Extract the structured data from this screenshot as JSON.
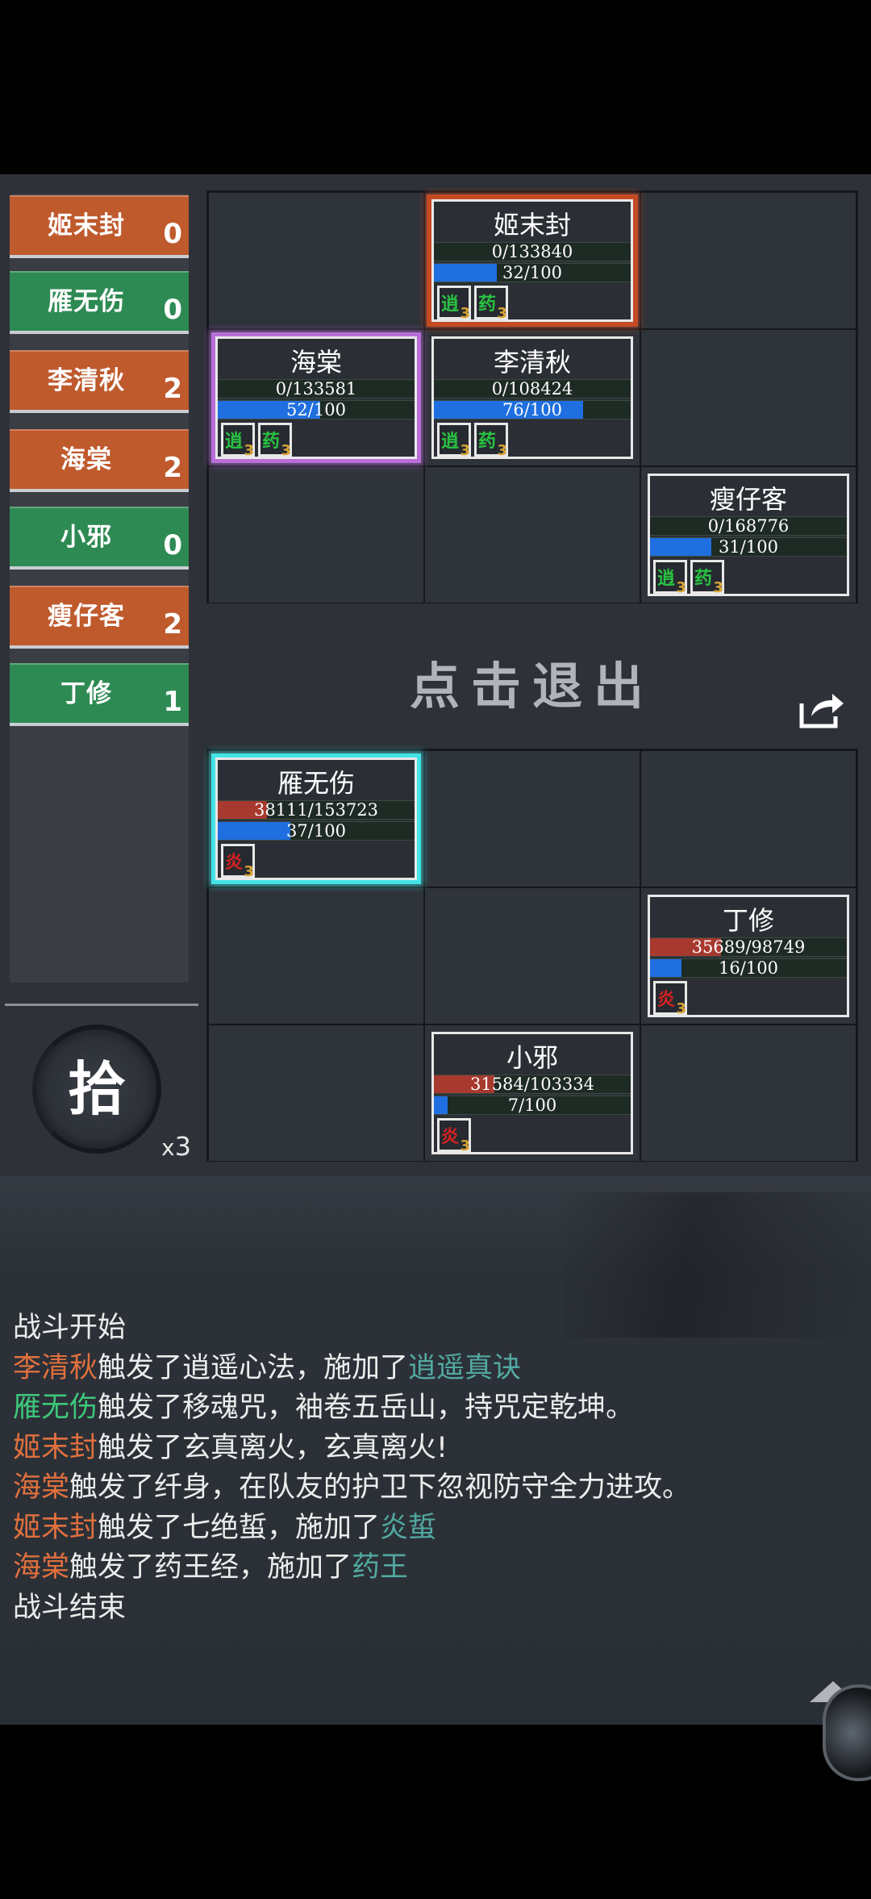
{
  "sidebar": {
    "items": [
      {
        "name": "姬末封",
        "count": "0",
        "color": "orange"
      },
      {
        "name": "雁无伤",
        "count": "0",
        "color": "green"
      },
      {
        "name": "李清秋",
        "count": "2",
        "color": "orange"
      },
      {
        "name": "海棠",
        "count": "2",
        "color": "orange"
      },
      {
        "name": "小邪",
        "count": "0",
        "color": "green"
      },
      {
        "name": "瘦仔客",
        "count": "2",
        "color": "orange"
      },
      {
        "name": "丁修",
        "count": "1",
        "color": "green"
      }
    ],
    "pick_button": "拾",
    "pick_count_prefix": "x",
    "pick_count": "3"
  },
  "exit_label": "点击退出",
  "enemy_cards": [
    {
      "name": "姬末封",
      "hp": "0/133840",
      "hp_fraction": 0,
      "energy": "32/100",
      "energy_fraction": 0.32,
      "buffs": [
        {
          "glyph": "逍",
          "count": "3",
          "color": "green"
        },
        {
          "glyph": "药",
          "count": "3",
          "color": "green"
        }
      ],
      "highlight": "orange"
    },
    {
      "name": "海棠",
      "hp": "0/133581",
      "hp_fraction": 0,
      "energy": "52/100",
      "energy_fraction": 0.52,
      "buffs": [
        {
          "glyph": "逍",
          "count": "3",
          "color": "green"
        },
        {
          "glyph": "药",
          "count": "3",
          "color": "green"
        }
      ],
      "highlight": "purple"
    },
    {
      "name": "李清秋",
      "hp": "0/108424",
      "hp_fraction": 0,
      "energy": "76/100",
      "energy_fraction": 0.76,
      "buffs": [
        {
          "glyph": "逍",
          "count": "3",
          "color": "green"
        },
        {
          "glyph": "药",
          "count": "3",
          "color": "green"
        }
      ],
      "highlight": "none"
    },
    {
      "name": "瘦仔客",
      "hp": "0/168776",
      "hp_fraction": 0,
      "energy": "31/100",
      "energy_fraction": 0.31,
      "buffs": [
        {
          "glyph": "逍",
          "count": "3",
          "color": "green"
        },
        {
          "glyph": "药",
          "count": "3",
          "color": "green"
        }
      ],
      "highlight": "none"
    }
  ],
  "ally_cards": [
    {
      "name": "雁无伤",
      "hp": "38111/153723",
      "hp_fraction": 0.248,
      "energy": "37/100",
      "energy_fraction": 0.37,
      "buffs": [
        {
          "glyph": "炎",
          "count": "3",
          "color": "red"
        }
      ],
      "highlight": "cyan"
    },
    {
      "name": "丁修",
      "hp": "35689/98749",
      "hp_fraction": 0.361,
      "energy": "16/100",
      "energy_fraction": 0.16,
      "buffs": [
        {
          "glyph": "炎",
          "count": "3",
          "color": "red"
        }
      ],
      "highlight": "none"
    },
    {
      "name": "小邪",
      "hp": "31584/103334",
      "hp_fraction": 0.306,
      "energy": "7/100",
      "energy_fraction": 0.07,
      "buffs": [
        {
          "glyph": "炎",
          "count": "3",
          "color": "red"
        }
      ],
      "highlight": "none"
    }
  ],
  "battle_log": [
    {
      "segments": [
        {
          "text": "战斗开始",
          "color": "white"
        }
      ]
    },
    {
      "segments": [
        {
          "text": "李清秋",
          "color": "orange"
        },
        {
          "text": "触发了逍遥心法，施加了",
          "color": "white"
        },
        {
          "text": "逍遥真诀",
          "color": "teal"
        }
      ]
    },
    {
      "segments": [
        {
          "text": "雁无伤",
          "color": "green"
        },
        {
          "text": "触发了移魂咒，袖卷五岳山，持咒定乾坤。",
          "color": "white"
        }
      ]
    },
    {
      "segments": [
        {
          "text": "姬末封",
          "color": "orange"
        },
        {
          "text": "触发了玄真离火，玄真离火!",
          "color": "white"
        }
      ]
    },
    {
      "segments": [
        {
          "text": "海棠",
          "color": "orange"
        },
        {
          "text": "触发了纤身，在队友的护卫下忽视防守全力进攻。",
          "color": "white"
        }
      ]
    },
    {
      "segments": [
        {
          "text": "姬末封",
          "color": "orange"
        },
        {
          "text": "触发了七绝蜇，施加了",
          "color": "white"
        },
        {
          "text": "炎蜇",
          "color": "teal"
        }
      ]
    },
    {
      "segments": [
        {
          "text": "海棠",
          "color": "orange"
        },
        {
          "text": "触发了药王经，施加了",
          "color": "white"
        },
        {
          "text": "药王",
          "color": "teal"
        }
      ]
    },
    {
      "segments": [
        {
          "text": "战斗结束",
          "color": "white"
        }
      ]
    }
  ],
  "colors": {
    "orange": "#bf5a2d",
    "green": "#2e8a53",
    "hp_bar": "#a7392f",
    "energy_bar": "#1f6fe0"
  }
}
